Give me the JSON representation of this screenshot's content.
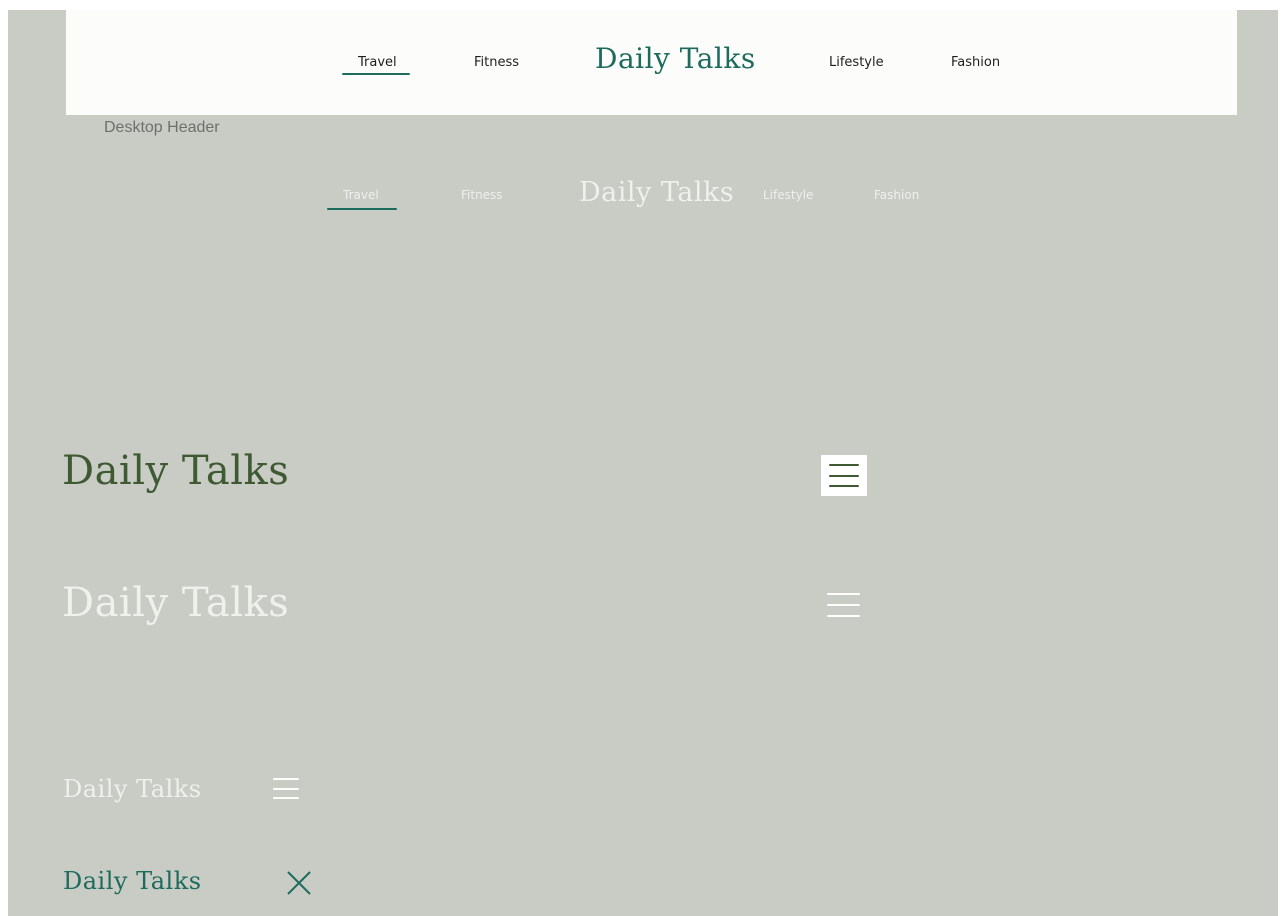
{
  "desktop_header": {
    "nav_left": [
      "Travel",
      "Fitness"
    ],
    "brand": "Daily Talks",
    "nav_right": [
      "Lifestyle",
      "Fashion"
    ],
    "active_item": "Travel"
  },
  "frame_label": "Desktop Header",
  "desktop_header_transparent": {
    "nav_left": [
      "Travel",
      "Fitness"
    ],
    "brand": "Daily Talks",
    "nav_right": [
      "Lifestyle",
      "Fashion"
    ],
    "active_item": "Travel"
  },
  "tablet_header_dark": {
    "brand": "Daily Talks",
    "menu_icon": "hamburger-icon"
  },
  "tablet_header_light": {
    "brand": "Daily Talks",
    "menu_icon": "hamburger-icon"
  },
  "mobile_header_closed": {
    "brand": "Daily Talks",
    "menu_icon": "hamburger-icon"
  },
  "mobile_header_open": {
    "brand": "Daily Talks",
    "menu_icon": "close-icon"
  },
  "colors": {
    "background": "#c9ccc5",
    "brand_green": "#1d6b5d",
    "brand_dark_green": "#3f5a33",
    "light_text": "#eef1ec"
  }
}
